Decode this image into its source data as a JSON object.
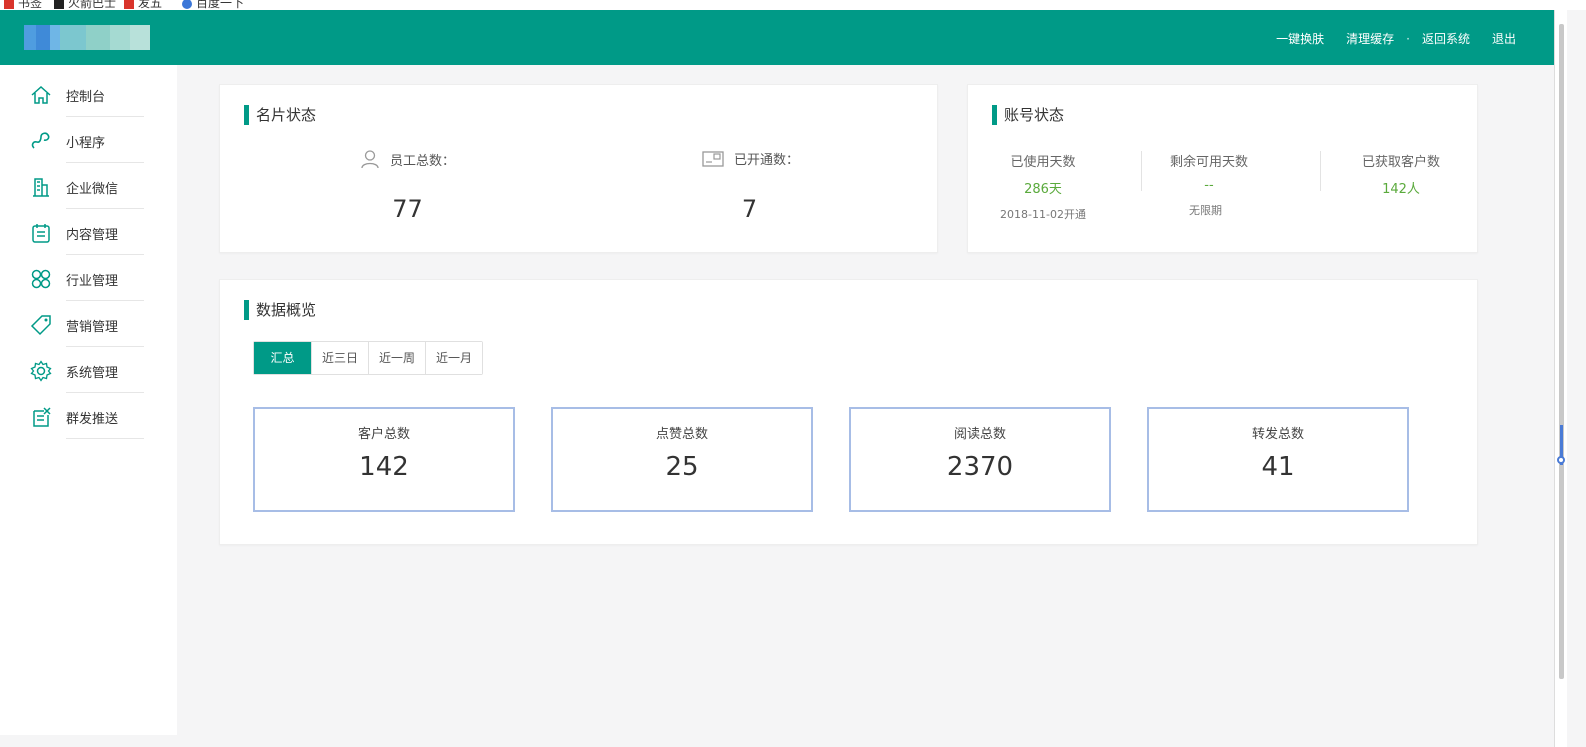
{
  "bookmarks": [
    "书签",
    "火箭巴士",
    "发五",
    "百度一下"
  ],
  "header": {
    "nav": [
      "一键换肤",
      "清理缓存",
      "返回系统",
      "退出"
    ],
    "separator": "·",
    "colors": {
      "primary": "#009a87"
    }
  },
  "sidebar": {
    "items": [
      {
        "label": "控制台",
        "icon": "home-icon"
      },
      {
        "label": "小程序",
        "icon": "link-icon"
      },
      {
        "label": "企业微信",
        "icon": "building-icon"
      },
      {
        "label": "内容管理",
        "icon": "clipboard-icon"
      },
      {
        "label": "行业管理",
        "icon": "grid-icon"
      },
      {
        "label": "营销管理",
        "icon": "tag-icon"
      },
      {
        "label": "系统管理",
        "icon": "gear-icon"
      },
      {
        "label": "群发推送",
        "icon": "broadcast-icon"
      }
    ]
  },
  "card_status": {
    "title": "名片状态",
    "employees": {
      "label": "员工总数：",
      "value": "77",
      "icon": "user-icon"
    },
    "opened": {
      "label": "已开通数：",
      "value": "7",
      "icon": "card-icon"
    }
  },
  "account_status": {
    "title": "账号状态",
    "columns": [
      {
        "title": "已使用天数",
        "value": "286天",
        "sub": "2018-11-02开通"
      },
      {
        "title": "剩余可用天数",
        "value": "--",
        "sub": "无限期"
      },
      {
        "title": "已获取客户数",
        "value": "142人",
        "sub": ""
      }
    ]
  },
  "overview": {
    "title": "数据概览",
    "tabs": [
      "汇总",
      "近三日",
      "近一周",
      "近一月"
    ],
    "active_tab": "汇总",
    "metrics": [
      {
        "label": "客户总数",
        "value": "142"
      },
      {
        "label": "点赞总数",
        "value": "25"
      },
      {
        "label": "阅读总数",
        "value": "2370"
      },
      {
        "label": "转发总数",
        "value": "41"
      }
    ]
  }
}
